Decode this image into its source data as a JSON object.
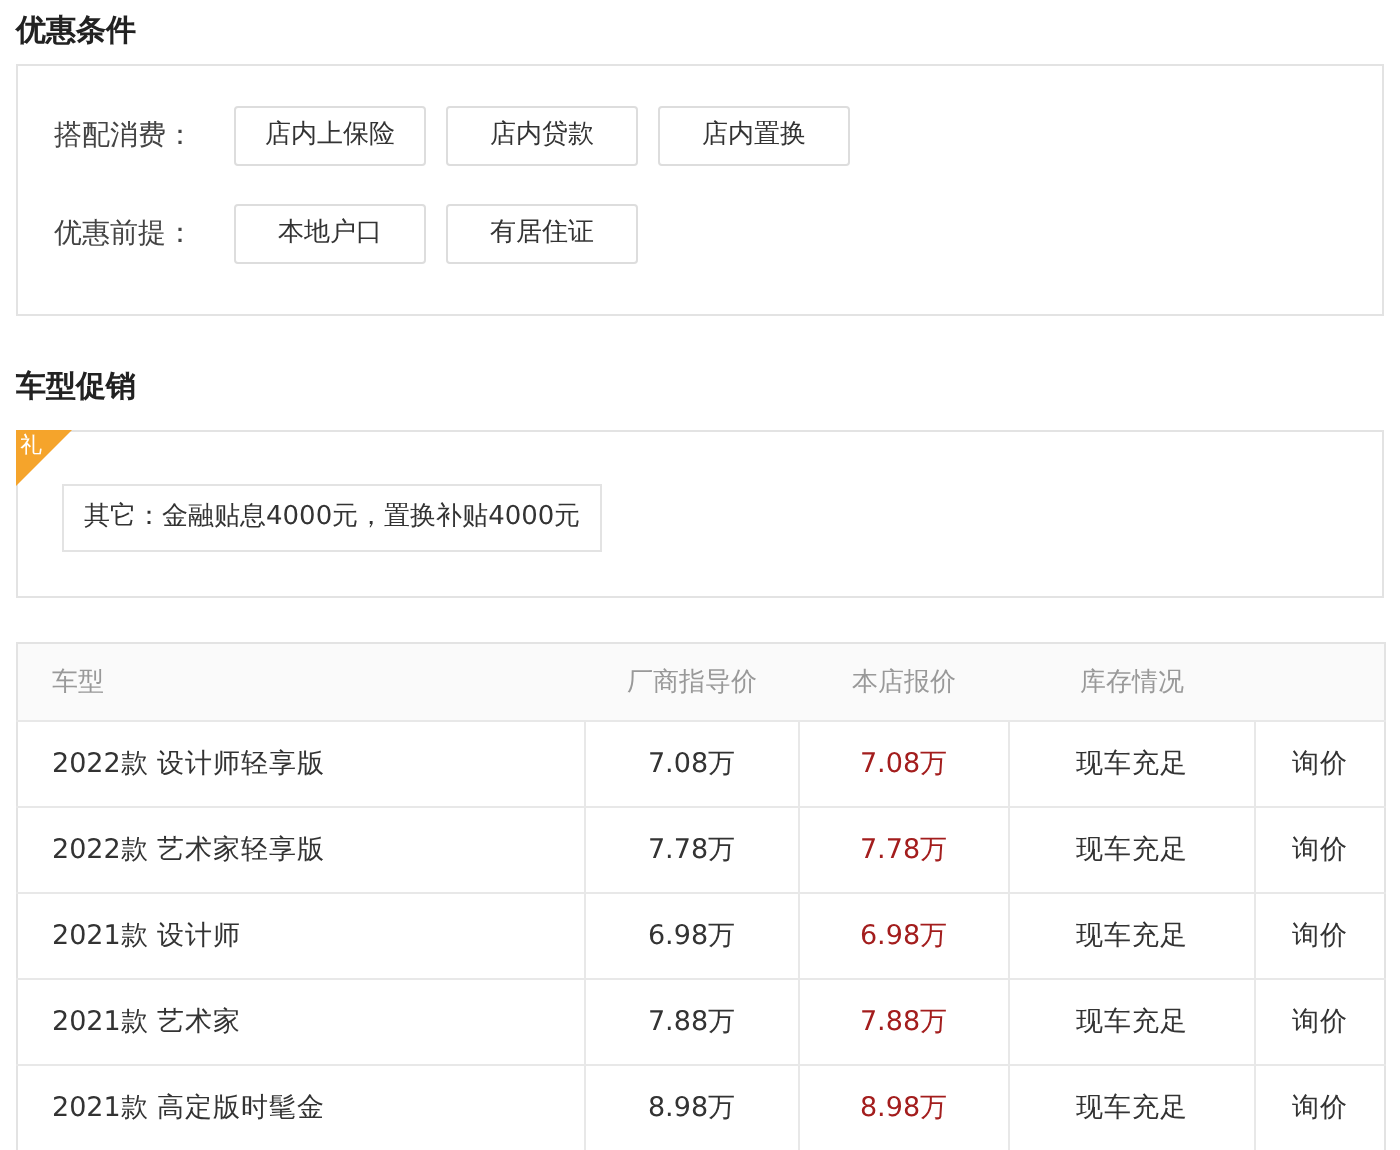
{
  "conditions": {
    "title": "优惠条件",
    "groups": [
      {
        "label": "搭配消费：",
        "options": [
          "店内上保险",
          "店内贷款",
          "店内置换"
        ]
      },
      {
        "label": "优惠前提：",
        "options": [
          "本地户口",
          "有居住证"
        ]
      }
    ]
  },
  "promotion": {
    "title": "车型促销",
    "badge": "礼",
    "text": "其它：金融贴息4000元，置换补贴4000元"
  },
  "table": {
    "columns": [
      "车型",
      "厂商指导价",
      "本店报价",
      "库存情况"
    ],
    "rows": [
      {
        "model": "2022款 设计师轻享版",
        "msrp": "7.08万",
        "price": "7.08万",
        "stock": "现车充足",
        "action": "询价"
      },
      {
        "model": "2022款 艺术家轻享版",
        "msrp": "7.78万",
        "price": "7.78万",
        "stock": "现车充足",
        "action": "询价"
      },
      {
        "model": "2021款 设计师",
        "msrp": "6.98万",
        "price": "6.98万",
        "stock": "现车充足",
        "action": "询价"
      },
      {
        "model": "2021款 艺术家",
        "msrp": "7.88万",
        "price": "7.88万",
        "stock": "现车充足",
        "action": "询价"
      },
      {
        "model": "2021款 高定版时髦金",
        "msrp": "8.98万",
        "price": "8.98万",
        "stock": "现车充足",
        "action": "询价"
      }
    ]
  }
}
